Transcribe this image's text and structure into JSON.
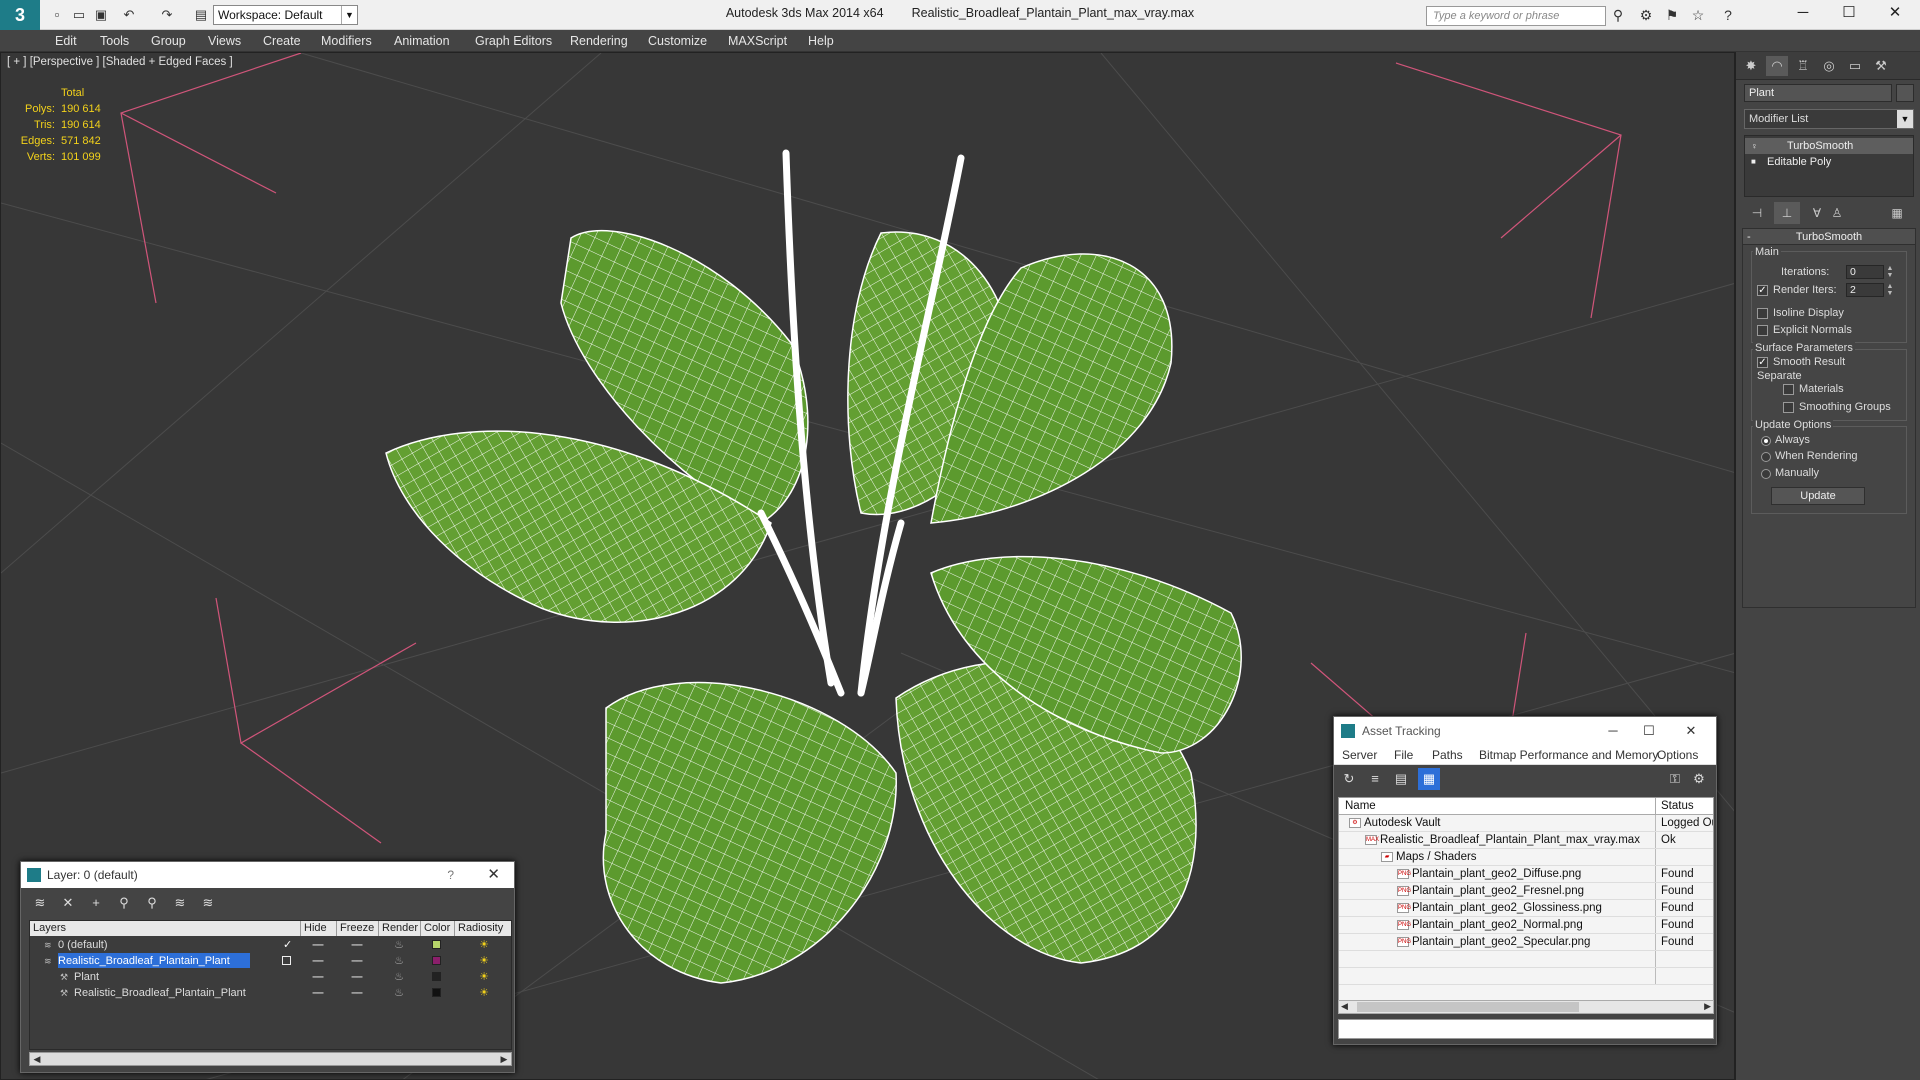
{
  "app": {
    "title": "Autodesk 3ds Max  2014 x64",
    "file": "Realistic_Broadleaf_Plantain_Plant_max_vray.max",
    "logo": "3",
    "workspace": "Workspace: Default",
    "search_placeholder": "Type a keyword or phrase"
  },
  "menu": [
    "Edit",
    "Tools",
    "Group",
    "Views",
    "Create",
    "Modifiers",
    "Animation",
    "Graph Editors",
    "Rendering",
    "Customize",
    "MAXScript",
    "Help"
  ],
  "viewport": {
    "label": "[ + ] [Perspective ] [Shaded + Edged Faces ]",
    "stats": {
      "header": "Total",
      "rows": [
        {
          "k": "Polys:",
          "v": "190 614"
        },
        {
          "k": "Tris:",
          "v": "190 614"
        },
        {
          "k": "Edges:",
          "v": "571 842"
        },
        {
          "k": "Verts:",
          "v": "101 099"
        }
      ]
    },
    "colors": {
      "background": "#373737",
      "grid": "#4a4a4a",
      "leaf": "#5c9a2e",
      "wire": "#ffffff",
      "bbox": "#d0557a"
    }
  },
  "command_panel": {
    "object_name": "Plant",
    "modifier_list": "Modifier List",
    "stack": [
      "TurboSmooth",
      "Editable Poly"
    ],
    "rollout": {
      "title": "TurboSmooth",
      "main": "Main",
      "iterations_label": "Iterations:",
      "iterations_value": "0",
      "render_iters_label": "Render Iters:",
      "render_iters_value": "2",
      "render_iters_checked": true,
      "isoline": "Isoline Display",
      "explicit": "Explicit Normals",
      "surface_params": "Surface Parameters",
      "smooth_result": "Smooth Result",
      "separate": "Separate",
      "materials": "Materials",
      "smoothing_groups": "Smoothing Groups",
      "update_options": "Update Options",
      "always": "Always",
      "when_rendering": "When Rendering",
      "manually": "Manually",
      "update": "Update"
    }
  },
  "layer_window": {
    "title": "Layer: 0 (default)",
    "help": "?",
    "columns": [
      "Layers",
      "Hide",
      "Freeze",
      "Render",
      "Color",
      "Radiosity"
    ],
    "rows": [
      {
        "name": "0 (default)",
        "indent": 0,
        "selected": false,
        "active": true,
        "color": "#b6d46a"
      },
      {
        "name": "Realistic_Broadleaf_Plantain_Plant",
        "indent": 0,
        "selected": true,
        "active": false,
        "color": "#8b1f6b"
      },
      {
        "name": "Plant",
        "indent": 1,
        "selected": false,
        "active": false,
        "color": "#222222"
      },
      {
        "name": "Realistic_Broadleaf_Plantain_Plant",
        "indent": 1,
        "selected": false,
        "active": false,
        "color": "#111111"
      }
    ]
  },
  "asset_tracking": {
    "title": "Asset Tracking",
    "menu": [
      "Server",
      "File",
      "Paths",
      "Bitmap Performance and Memory",
      "Options"
    ],
    "columns": [
      "Name",
      "Status"
    ],
    "rows": [
      {
        "name": "Autodesk Vault",
        "status": "Logged Ou",
        "indent": 1,
        "icon": "vault-icon"
      },
      {
        "name": "Realistic_Broadleaf_Plantain_Plant_max_vray.max",
        "status": "Ok",
        "indent": 2,
        "icon": "max-file-icon"
      },
      {
        "name": "Maps / Shaders",
        "status": "",
        "indent": 3,
        "icon": "maps-icon"
      },
      {
        "name": "Plantain_plant_geo2_Diffuse.png",
        "status": "Found",
        "indent": 4,
        "icon": "png-icon"
      },
      {
        "name": "Plantain_plant_geo2_Fresnel.png",
        "status": "Found",
        "indent": 4,
        "icon": "png-icon"
      },
      {
        "name": "Plantain_plant_geo2_Glossiness.png",
        "status": "Found",
        "indent": 4,
        "icon": "png-icon"
      },
      {
        "name": "Plantain_plant_geo2_Normal.png",
        "status": "Found",
        "indent": 4,
        "icon": "png-icon"
      },
      {
        "name": "Plantain_plant_geo2_Specular.png",
        "status": "Found",
        "indent": 4,
        "icon": "png-icon"
      }
    ]
  }
}
